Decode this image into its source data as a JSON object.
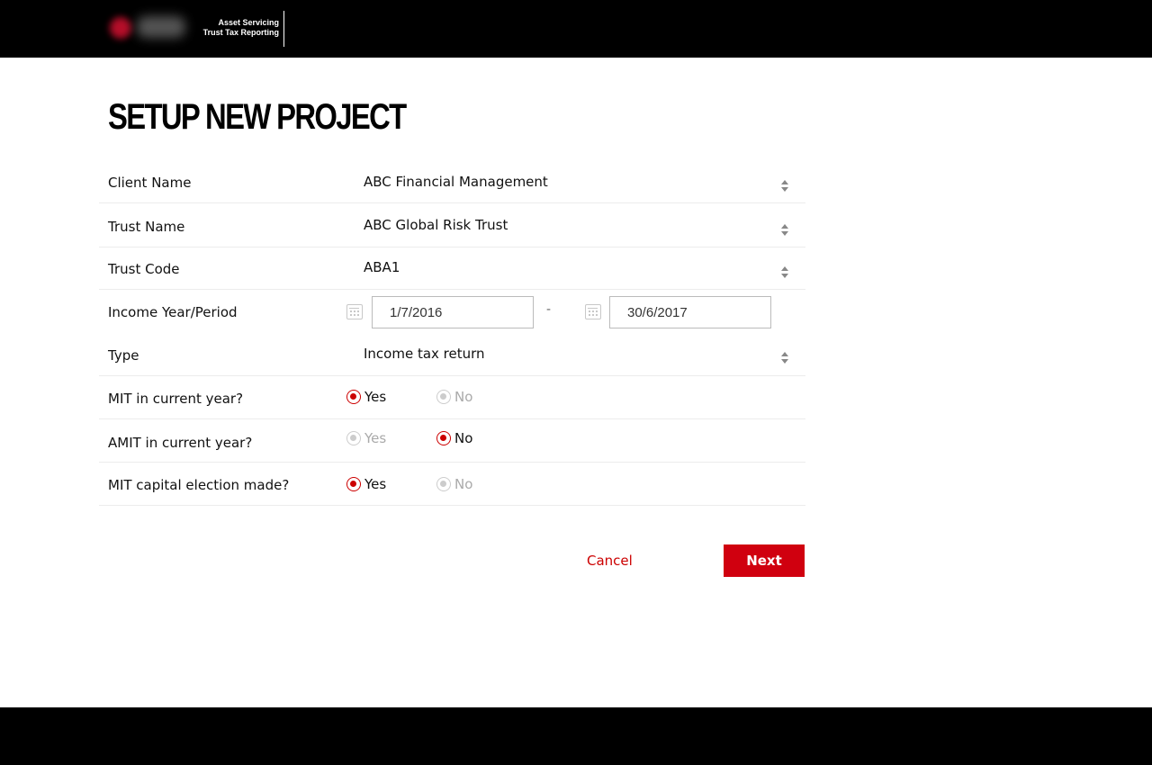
{
  "header": {
    "brand_line1": "Asset Servicing",
    "brand_line2": "Trust Tax Reporting"
  },
  "page_title": "SETUP NEW PROJECT",
  "form": {
    "client_name": {
      "label": "Client Name",
      "value": "ABC Financial Management"
    },
    "trust_name": {
      "label": "Trust Name",
      "value": "ABC Global Risk Trust"
    },
    "trust_code": {
      "label": "Trust Code",
      "value": "ABA1"
    },
    "income_period": {
      "label": "Income Year/Period",
      "start": "1/7/2016",
      "separator": "-",
      "end": "30/6/2017"
    },
    "type": {
      "label": "Type",
      "value": "Income tax return"
    },
    "mit_current": {
      "label": "MIT in current year?",
      "yes": "Yes",
      "no": "No",
      "selected": "Yes"
    },
    "amit_current": {
      "label": "AMIT in current year?",
      "yes": "Yes",
      "no": "No",
      "selected": "No"
    },
    "mit_capital": {
      "label": "MIT capital election made?",
      "yes": "Yes",
      "no": "No",
      "selected": "Yes"
    }
  },
  "actions": {
    "cancel_label": "Cancel",
    "next_label": "Next"
  },
  "colors": {
    "accent": "#d0000f",
    "header_bg": "#000000",
    "disabled": "#cccccc"
  }
}
